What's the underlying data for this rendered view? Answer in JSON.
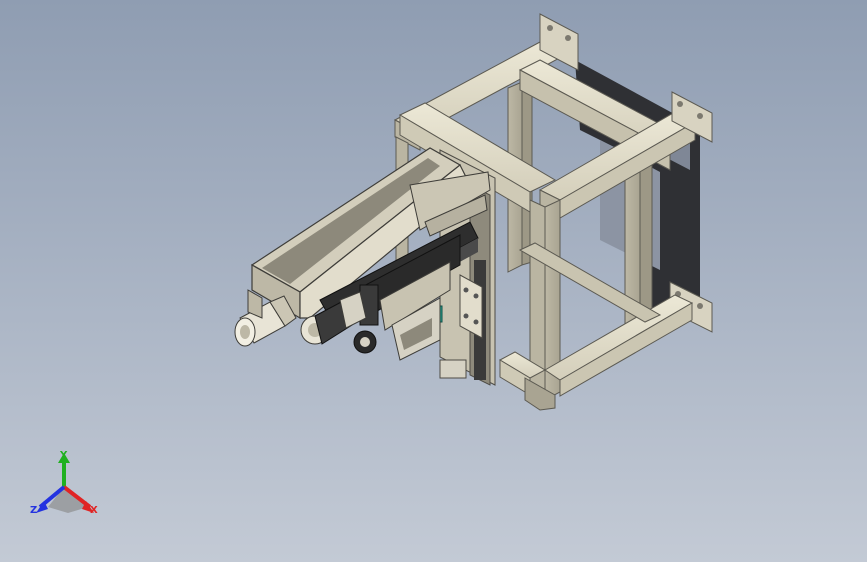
{
  "viewport": {
    "background_top": "#8f9db2",
    "background_bottom": "#c3cad5",
    "model_name": "",
    "frame_color": "#cdc8b6",
    "frame_shadow_color": "#2f3034"
  },
  "triad": {
    "x_label": "X",
    "y_label": "Y",
    "z_label": "Z",
    "x_color": "#e02424",
    "y_color": "#20b020",
    "z_color": "#2433e0"
  }
}
